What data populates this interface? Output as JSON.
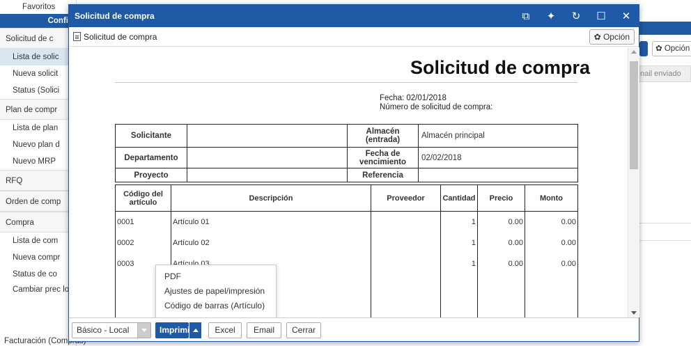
{
  "background": {
    "favoritos": "Favoritos",
    "config": "Config",
    "sidebar": [
      {
        "label": "Solicitud de c",
        "type": "group"
      },
      {
        "label": "Lista de solic",
        "type": "active"
      },
      {
        "label": "Nueva solicit",
        "type": "item"
      },
      {
        "label": "Status (Solici",
        "type": "item"
      },
      {
        "label": "Plan de compr",
        "type": "group"
      },
      {
        "label": "Lista de plan",
        "type": "item"
      },
      {
        "label": "Nuevo plan d",
        "type": "item"
      },
      {
        "label": "Nuevo MRP",
        "type": "item"
      },
      {
        "label": "RFQ",
        "type": "group"
      },
      {
        "label": "Orden de comp",
        "type": "group"
      },
      {
        "label": "Compra",
        "type": "group"
      },
      {
        "label": "Lista de com",
        "type": "item"
      },
      {
        "label": "Nueva compr",
        "type": "item"
      },
      {
        "label": "Status de co",
        "type": "item"
      },
      {
        "label": "Cambiar prec lote",
        "type": "two"
      }
    ],
    "bottom_item": "Facturación (Compras)",
    "right_option": "Opción",
    "right_email_col": "nail enviado"
  },
  "modal": {
    "title": "Solicitud de compra",
    "subtitle": "Solicitud de compra",
    "option_button": "Opción",
    "document": {
      "title": "Solicitud de compra",
      "fecha": "Fecha: 02/01/2018",
      "numero": "Número de solicitud de compra:",
      "info": {
        "solicitante_label": "Solicitante",
        "solicitante_value": "",
        "almacen_label": "Almacén (entrada)",
        "almacen_value": "Almacén principal",
        "departamento_label": "Departamento",
        "departamento_value": "",
        "vencimiento_label": "Fecha de vencimiento",
        "vencimiento_value": "02/02/2018",
        "proyecto_label": "Proyecto",
        "proyecto_value": "",
        "referencia_label": "Referencia",
        "referencia_value": ""
      },
      "columns": [
        "Código del artículo",
        "Descripción",
        "Proveedor",
        "Cantidad",
        "Precio",
        "Monto"
      ],
      "rows": [
        {
          "code": "0001",
          "desc": "Artículo 01",
          "prov": "",
          "qty": "1",
          "price": "0.00",
          "amount": "0.00"
        },
        {
          "code": "0002",
          "desc": "Artículo 02",
          "prov": "",
          "qty": "1",
          "price": "0.00",
          "amount": "0.00"
        },
        {
          "code": "0003",
          "desc": "Artículo 03",
          "prov": "",
          "qty": "1",
          "price": "0.00",
          "amount": "0.00"
        }
      ]
    },
    "menu": [
      "PDF",
      "Ajustes de papel/impresión",
      "Código de barras (Artículo)"
    ],
    "footer": {
      "select_value": "Básico - Local",
      "print": "Imprimir",
      "excel": "Excel",
      "email": "Email",
      "cerrar": "Cerrar"
    }
  }
}
